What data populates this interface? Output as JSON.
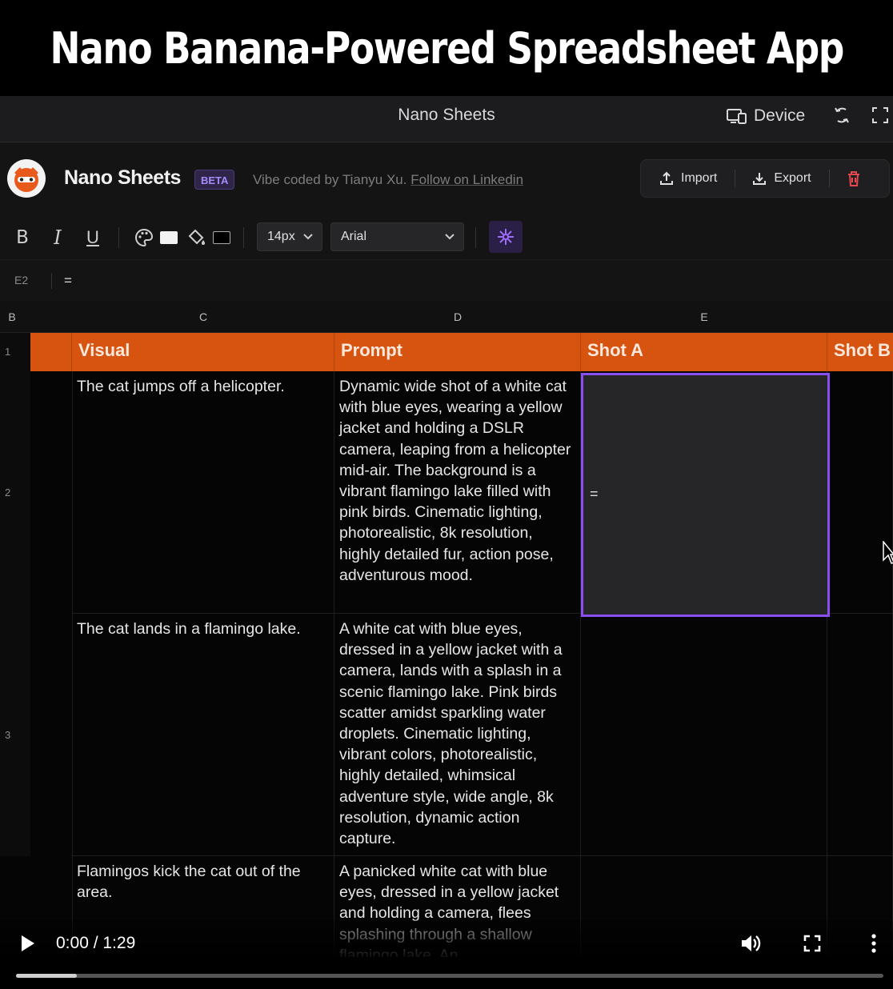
{
  "banner": {
    "title": "Nano Banana-Powered Spreadsheet App"
  },
  "titlebar": {
    "title": "Nano Sheets",
    "device_label": "Device"
  },
  "app": {
    "name": "Nano Sheets",
    "badge": "BETA",
    "credit": "Vibe coded by Tianyu Xu.",
    "credit_link": "Follow on Linkedin",
    "import_label": "Import",
    "export_label": "Export"
  },
  "toolbar": {
    "font_size": "14px",
    "font_family": "Arial",
    "icons": [
      "bold-icon",
      "italic-icon",
      "underline-icon",
      "palette-icon",
      "text-color-swatch",
      "fill-bucket-icon",
      "fill-color-swatch",
      "sparkle-ai-icon"
    ]
  },
  "formula": {
    "cell_ref": "E2",
    "value": "="
  },
  "grid": {
    "columns": [
      "B",
      "C",
      "D",
      "E"
    ],
    "rows": [
      "1",
      "2",
      "3"
    ],
    "header": [
      "Visual",
      "Prompt",
      "Shot A",
      "Shot B"
    ],
    "data": [
      {
        "visual": "The cat jumps off a helicopter.",
        "prompt": "Dynamic wide shot of a white cat with blue eyes, wearing a yellow jacket and holding a DSLR camera, leaping from a helicopter mid-air. The background is a vibrant flamingo lake filled with pink birds. Cinematic lighting, photorealistic, 8k resolution, highly detailed fur, action pose, adventurous mood.",
        "shot_a": "=",
        "shot_b": ""
      },
      {
        "visual": "The cat lands in a flamingo lake.",
        "prompt": "A white cat with blue eyes, dressed in a yellow jacket with a camera, lands with a splash in a scenic flamingo lake. Pink birds scatter amidst sparkling water droplets. Cinematic lighting, vibrant colors, photorealistic, highly detailed, whimsical adventure style, wide angle, 8k resolution, dynamic action capture.",
        "shot_a": "",
        "shot_b": ""
      },
      {
        "visual": "Flamingos kick the cat out of the area.",
        "prompt": "A panicked white cat with blue eyes, dressed in a yellow jacket and holding a camera, flees splashing through a shallow flamingo lake. An",
        "shot_a": "",
        "shot_b": ""
      }
    ]
  },
  "video": {
    "time": "0:00 / 1:29",
    "progress": 0.07
  },
  "colors": {
    "header_orange": "#d75410",
    "selection_purple": "#8b4ef0",
    "accent_violet": "#a78bfa",
    "delete_red": "#e5484d"
  }
}
